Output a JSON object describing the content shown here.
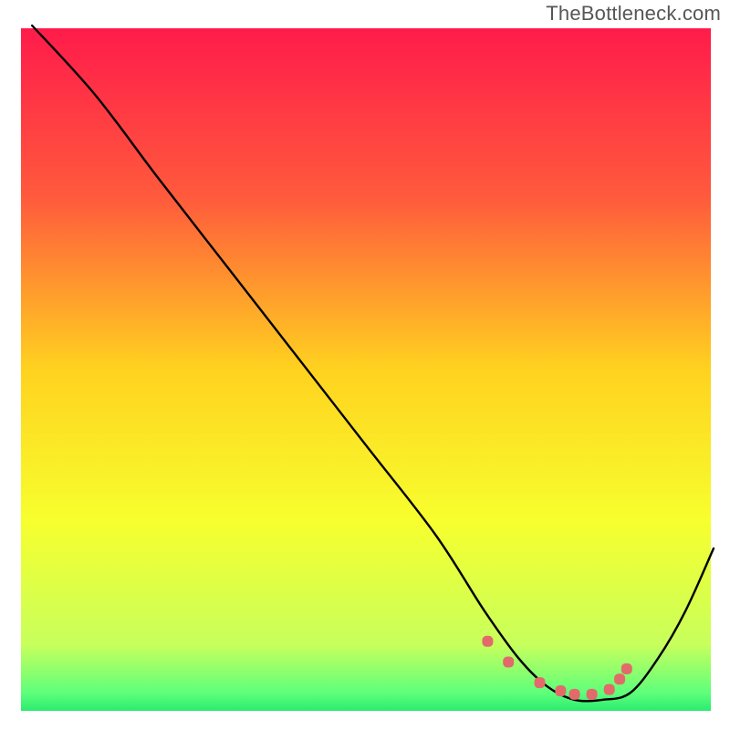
{
  "watermark": "TheBottleneck.com",
  "chart_data": {
    "type": "line",
    "title": "",
    "xlabel": "",
    "ylabel": "",
    "xlim": [
      0,
      100
    ],
    "ylim": [
      0,
      100
    ],
    "gradient_stops": [
      {
        "offset": 0.0,
        "color": "#ff1a4b"
      },
      {
        "offset": 0.25,
        "color": "#ff5a3c"
      },
      {
        "offset": 0.5,
        "color": "#ffd21f"
      },
      {
        "offset": 0.72,
        "color": "#f7ff2e"
      },
      {
        "offset": 0.9,
        "color": "#c7ff5c"
      },
      {
        "offset": 0.97,
        "color": "#5eff7b"
      },
      {
        "offset": 1.0,
        "color": "#23e86e"
      }
    ],
    "series": [
      {
        "name": "curve",
        "x": [
          2,
          11,
          20,
          30,
          40,
          50,
          60,
          67,
          72,
          76,
          80,
          84,
          88,
          92,
          96,
          100
        ],
        "y": [
          100,
          90,
          78,
          65,
          52,
          39,
          26,
          15,
          8,
          4,
          2,
          2,
          3,
          8,
          15,
          24
        ]
      }
    ],
    "markers": {
      "x": [
        67.5,
        70.5,
        75,
        78,
        80,
        82.5,
        85,
        86.5,
        87.5
      ],
      "y": [
        10.5,
        7.5,
        4.5,
        3.3,
        2.8,
        2.8,
        3.5,
        5.0,
        6.5
      ],
      "color": "#e26a6a",
      "radius": 6
    }
  }
}
